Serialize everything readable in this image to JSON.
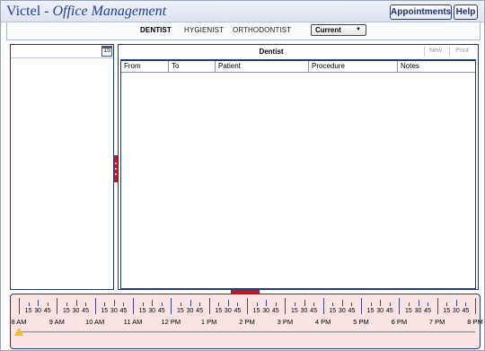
{
  "app": {
    "title_main": "Victel - ",
    "title_sub": "Office Management"
  },
  "header_buttons": {
    "appointments": "Appointments",
    "help": "Help"
  },
  "nav": {
    "tabs": [
      {
        "label": "DENTIST",
        "active": true
      },
      {
        "label": "HYGIENIST",
        "active": false
      },
      {
        "label": "ORTHODONTIST",
        "active": false
      }
    ],
    "view_select": {
      "value": "Current"
    }
  },
  "left_panel": {
    "calendar_icon": {
      "icon": "calendar-icon",
      "day": "15"
    }
  },
  "main_panel": {
    "title": "Dentist",
    "new_label": "New",
    "print_label": "Print",
    "columns": [
      "From",
      "To",
      "Patient",
      "Procedure",
      "Notes"
    ],
    "rows": []
  },
  "timeline": {
    "hours": [
      "8 AM",
      "9 AM",
      "10 AM",
      "11 AM",
      "12 PM",
      "1 PM",
      "2 PM",
      "3 PM",
      "4 PM",
      "5 PM",
      "6 PM",
      "7 PM",
      "8 PM"
    ],
    "minute_marks": [
      "15",
      "30",
      "45"
    ],
    "thumb_position_hours": 8.0
  },
  "colors": {
    "brand_blue": "#1f3f8f",
    "border_navy": "#223a80",
    "splitter_red": "#c0181f",
    "timeline_bg": "#fbe3e3",
    "thumb_yellow": "#f0c020"
  }
}
